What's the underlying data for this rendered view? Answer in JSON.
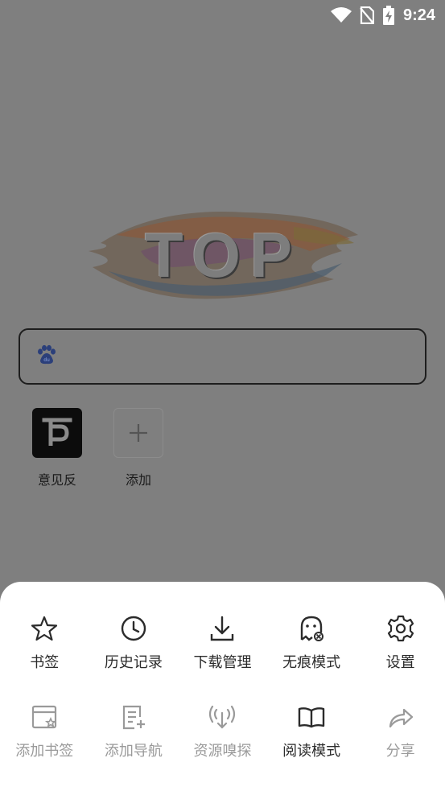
{
  "status_bar": {
    "time": "9:24",
    "icons": [
      "wifi-icon",
      "no-sim-icon",
      "battery-charging-icon"
    ]
  },
  "logo": {
    "text": "TOP"
  },
  "search": {
    "placeholder": "",
    "value": "",
    "engine_icon": "baidu-paw-icon"
  },
  "shortcuts": [
    {
      "label": "意见反",
      "icon": "feedback-app-icon"
    },
    {
      "label": "添加",
      "icon": "plus-icon"
    }
  ],
  "menu": {
    "row1": [
      {
        "label": "书签",
        "icon": "star-icon",
        "enabled": true
      },
      {
        "label": "历史记录",
        "icon": "clock-icon",
        "enabled": true
      },
      {
        "label": "下载管理",
        "icon": "download-icon",
        "enabled": true
      },
      {
        "label": "无痕模式",
        "icon": "ghost-icon",
        "enabled": true
      },
      {
        "label": "设置",
        "icon": "gear-icon",
        "enabled": true
      }
    ],
    "row2": [
      {
        "label": "添加书签",
        "icon": "add-bookmark-icon",
        "enabled": false
      },
      {
        "label": "添加导航",
        "icon": "add-navigation-icon",
        "enabled": false
      },
      {
        "label": "资源嗅探",
        "icon": "resource-sniff-icon",
        "enabled": false
      },
      {
        "label": "阅读模式",
        "icon": "book-icon",
        "enabled": true
      },
      {
        "label": "分享",
        "icon": "share-icon",
        "enabled": false
      }
    ]
  },
  "colors": {
    "overlay": "#7f7f7f",
    "sheet": "#ffffff",
    "icon_active": "#2b2b2b",
    "icon_disabled": "#9a9a9a"
  }
}
